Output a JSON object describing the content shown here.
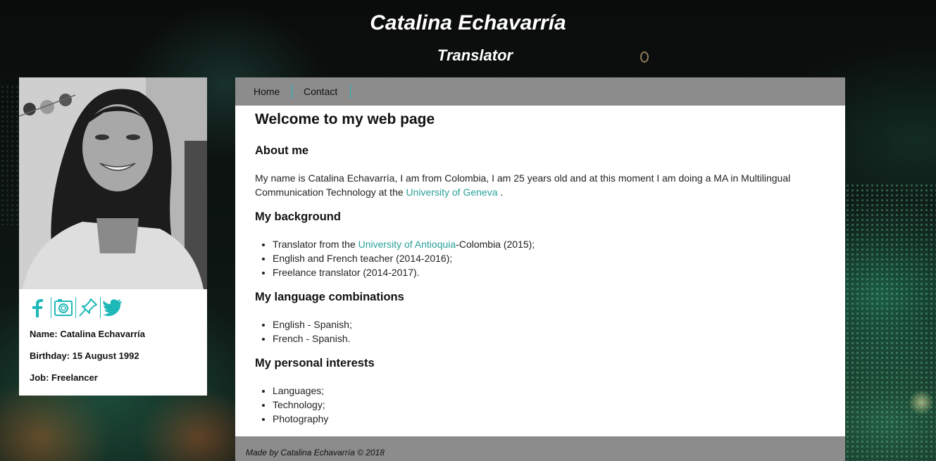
{
  "header": {
    "title": "Catalina Echavarría",
    "subtitle": "Translator"
  },
  "sidebar": {
    "social_icons": [
      "facebook-icon",
      "instagram-icon",
      "blog-pin-icon",
      "twitter-icon"
    ],
    "name_line": "Name: Catalina Echavarría",
    "birthday_line": "Birthday: 15 August 1992",
    "job_line": "Job: Freelancer"
  },
  "nav": {
    "home": "Home",
    "contact": "Contact"
  },
  "main": {
    "heading": "Welcome to my web page",
    "about": {
      "title": "About me",
      "text": "My name is Catalina Echavarría, I am from Colombia, I am 25 years old and at this moment I am doing a MA in Multilingual Communication Technology at the ",
      "link": "University of Geneva",
      "text_end": " ."
    },
    "background": {
      "title": "My background",
      "item1_pre": "Translator from the ",
      "item1_link": "University of Antioquia",
      "item1_post": "-Colombia (2015);",
      "item2": "English and French teacher (2014-2016);",
      "item3": "Freelance translator (2014-2017)."
    },
    "languages": {
      "title": "My language combinations",
      "item1": "English - Spanish;",
      "item2": "French - Spanish."
    },
    "interests": {
      "title": "My personal interests",
      "item1": "Languages;",
      "item2": "Technology;",
      "item3": "Photography"
    }
  },
  "footer": {
    "text": "Made by Catalina Echavarría © 2018"
  },
  "colors": {
    "accent": "#2aa198",
    "icon": "#1fb8b8",
    "nav_bg": "#8c8c8c"
  }
}
